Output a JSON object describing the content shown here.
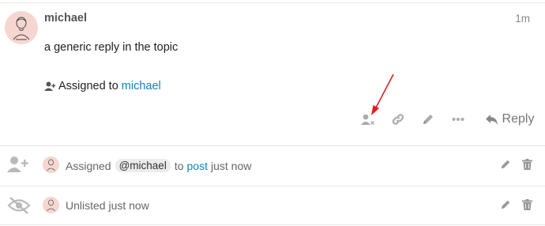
{
  "post": {
    "username": "michael",
    "date": "1m",
    "body": "a generic reply in the topic",
    "assigned_prefix": "Assigned to",
    "assigned_user": "michael",
    "reply_label": "Reply",
    "action_icons": [
      "assign-user-icon",
      "link-icon",
      "pencil-icon",
      "more-icon",
      "reply-icon"
    ]
  },
  "small_actions": [
    {
      "icon": "user-plus-icon",
      "prefix": "Assigned",
      "mention": "@michael",
      "middle": "to",
      "link": "post",
      "suffix": "just now"
    },
    {
      "icon": "eye-slash-icon",
      "text": "Unlisted just now"
    }
  ],
  "colors": {
    "link": "#0a84c1",
    "annotation_arrow": "#e02020",
    "icon_gray": "#aaaaaa",
    "avatar_bg": "#f6d6d0"
  }
}
